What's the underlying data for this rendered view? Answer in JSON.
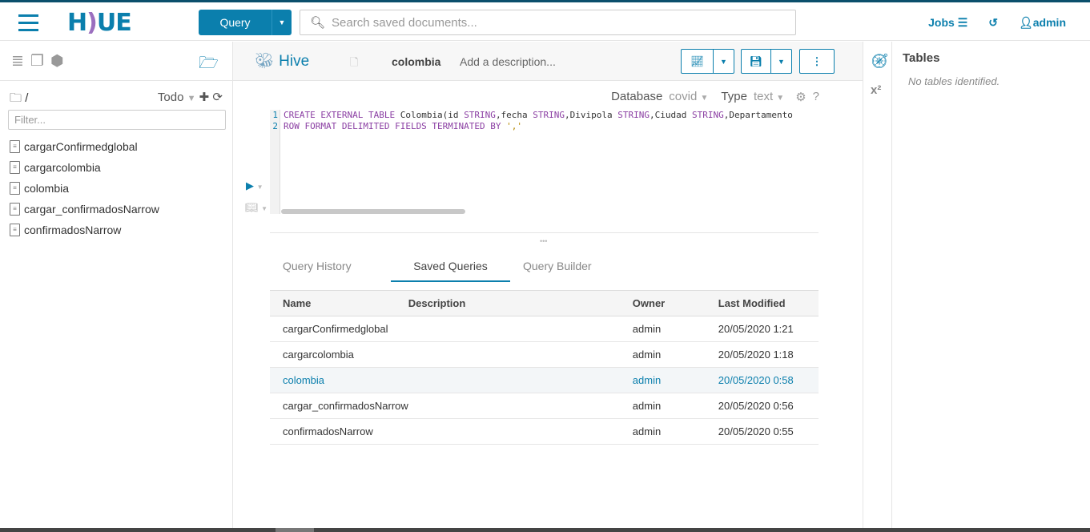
{
  "header": {
    "logo": "HUE",
    "query_button": "Query",
    "search_placeholder": "Search saved documents...",
    "jobs": "Jobs",
    "user": "admin"
  },
  "sidebar": {
    "path": "/",
    "filter_label": "Todo",
    "filter_placeholder": "Filter...",
    "files": [
      "cargarConfirmedglobal",
      "cargarcolombia",
      "colombia",
      "cargar_confirmadosNarrow",
      "confirmadosNarrow"
    ]
  },
  "editor": {
    "engine": "Hive",
    "doc_name": "colombia",
    "description_placeholder": "Add a description...",
    "database_label": "Database",
    "database_value": "covid",
    "type_label": "Type",
    "type_value": "text",
    "help": "?",
    "line_numbers": [
      "1",
      "2"
    ],
    "code": [
      [
        {
          "k": "kw",
          "t": "CREATE EXTERNAL TABLE "
        },
        {
          "k": "id",
          "t": "Colombia(id "
        },
        {
          "k": "kw",
          "t": "STRING"
        },
        {
          "k": "id",
          "t": ",fecha "
        },
        {
          "k": "kw",
          "t": "STRING"
        },
        {
          "k": "id",
          "t": ",Divipola "
        },
        {
          "k": "kw",
          "t": "STRING"
        },
        {
          "k": "id",
          "t": ",Ciudad "
        },
        {
          "k": "kw",
          "t": "STRING"
        },
        {
          "k": "id",
          "t": ",Departamento"
        }
      ],
      [
        {
          "k": "kw",
          "t": "ROW FORMAT DELIMITED FIELDS TERMINATED BY "
        },
        {
          "k": "str",
          "t": "','"
        }
      ]
    ]
  },
  "tabs": [
    "Query History",
    "Saved Queries",
    "Query Builder"
  ],
  "table": {
    "headers": [
      "Name",
      "Description",
      "Owner",
      "Last Modified"
    ],
    "rows": [
      [
        "cargarConfirmedglobal",
        "",
        "admin",
        "20/05/2020 1:21"
      ],
      [
        "cargarcolombia",
        "",
        "admin",
        "20/05/2020 1:18"
      ],
      [
        "colombia",
        "",
        "admin",
        "20/05/2020 0:58"
      ],
      [
        "cargar_confirmadosNarrow",
        "",
        "admin",
        "20/05/2020 0:56"
      ],
      [
        "confirmadosNarrow",
        "",
        "admin",
        "20/05/2020 0:55"
      ]
    ]
  },
  "right_panel": {
    "title": "Tables",
    "empty": "No tables identified."
  },
  "colors": {
    "accent": "#0b7fad",
    "keyword": "#8b3fa3"
  }
}
